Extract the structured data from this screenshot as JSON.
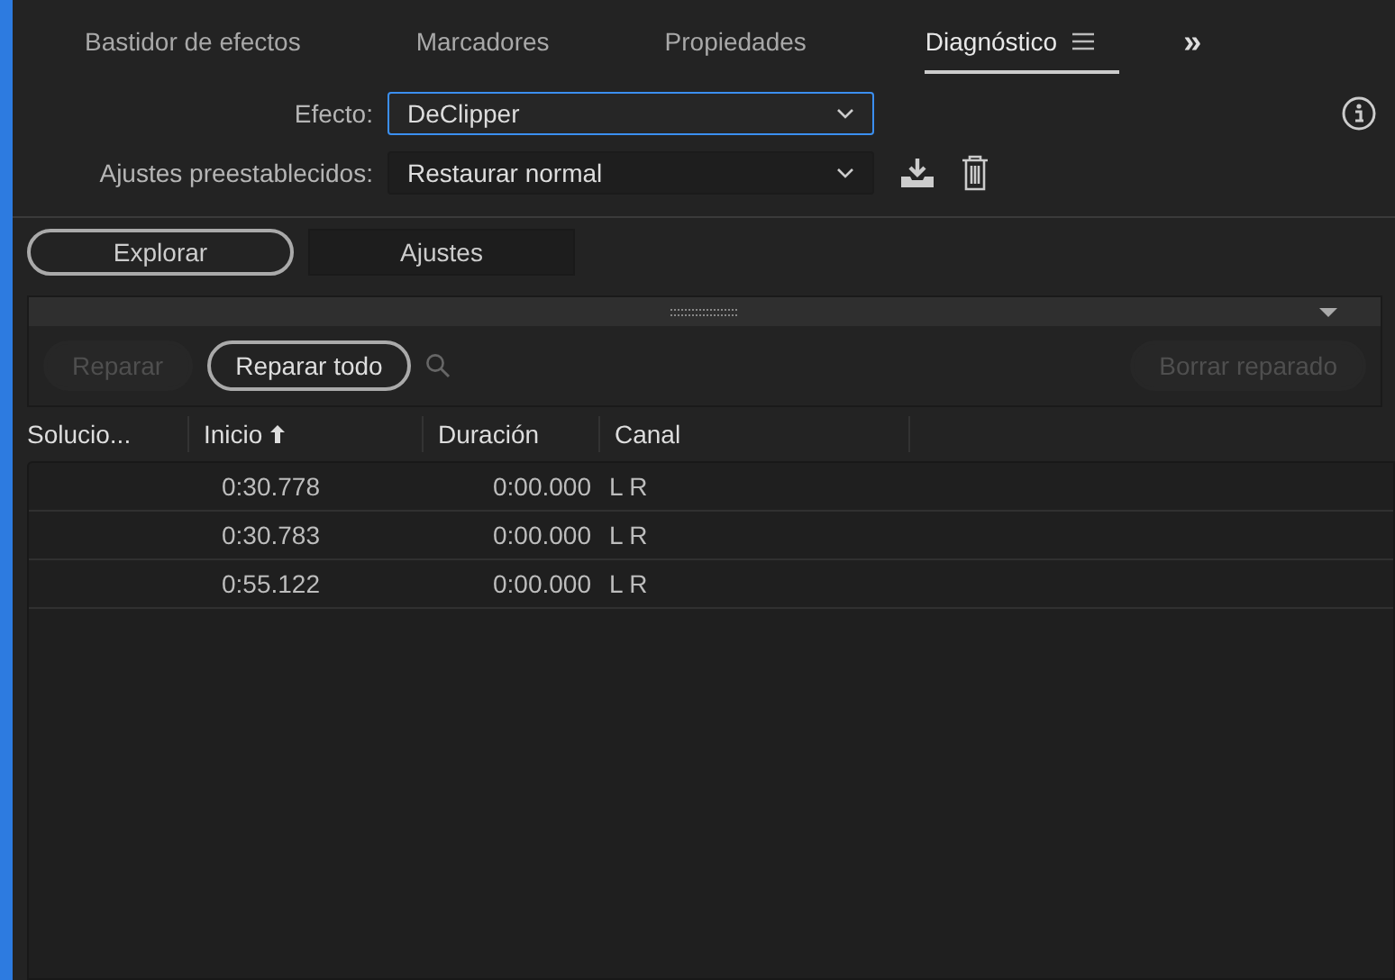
{
  "tabs": [
    {
      "label": "Bastidor de efectos",
      "selected": false
    },
    {
      "label": "Marcadores",
      "selected": false
    },
    {
      "label": "Propiedades",
      "selected": false
    },
    {
      "label": "Diagnóstico",
      "selected": true
    }
  ],
  "overflow": "»",
  "effect": {
    "label": "Efecto:",
    "value": "DeClipper",
    "focused": true
  },
  "preset": {
    "label": "Ajustes preestablecidos:",
    "value": "Restaurar normal",
    "focused": false
  },
  "mode_tabs": [
    {
      "label": "Explorar",
      "selected": true
    },
    {
      "label": "Ajustes",
      "selected": false
    }
  ],
  "actions": [
    {
      "label": "Reparar",
      "disabled": true
    },
    {
      "label": "Reparar todo",
      "disabled": false
    }
  ],
  "clear_button": {
    "label": "Borrar reparado",
    "disabled": true
  },
  "table": {
    "columns": [
      "Solucio...",
      "Inicio",
      "Duración",
      "Canal"
    ],
    "rows": [
      {
        "inicio": "0:30.778",
        "duracion": "0:00.000",
        "canal": "L R"
      },
      {
        "inicio": "0:30.783",
        "duracion": "0:00.000",
        "canal": "L R"
      },
      {
        "inicio": "0:55.122",
        "duracion": "0:00.000",
        "canal": "L R"
      }
    ]
  }
}
